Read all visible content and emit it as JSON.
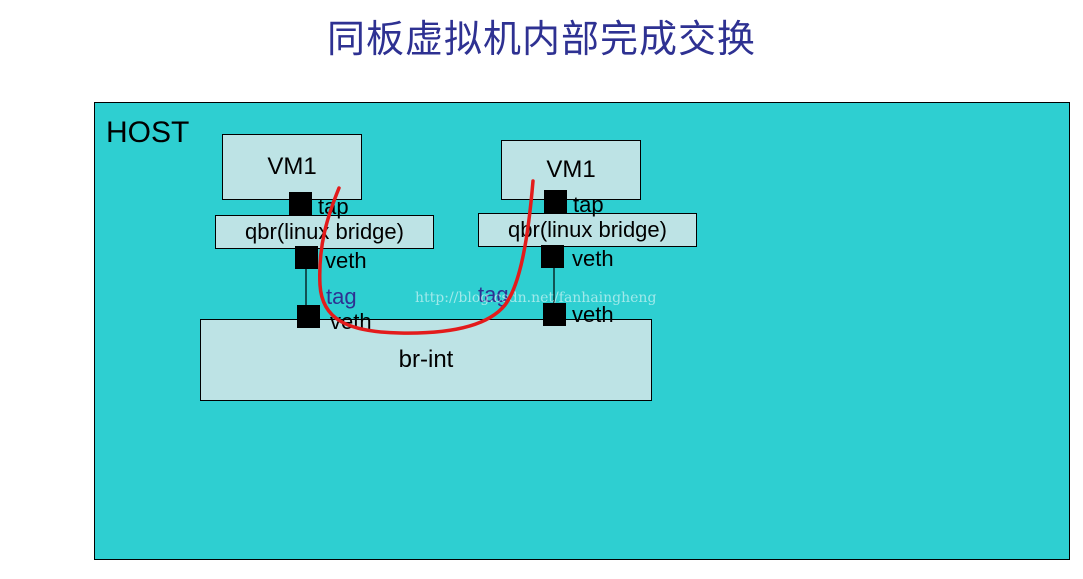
{
  "title": "同板虚拟机内部完成交换",
  "host_label": "HOST",
  "left": {
    "vm_label": "VM1",
    "tap_label": "tap",
    "qbr_label": "qbr(linux bridge)",
    "veth_top_label": "veth",
    "tag_label": "tag",
    "veth_bottom_label": "veth"
  },
  "right": {
    "vm_label": "VM1",
    "tap_label": "tap",
    "qbr_label": "qbr(linux bridge)",
    "veth_top_label": "veth",
    "tag_label": "tag",
    "veth_bottom_label": "veth"
  },
  "brint_label": "br-int",
  "watermark": "http://blog.csdn.net/fanhaingheng",
  "colors": {
    "title": "#2e3192",
    "host_bg": "#2ecfd1",
    "box_bg": "#bde3e5",
    "path": "#e31b1b",
    "tag": "#2e3192"
  }
}
